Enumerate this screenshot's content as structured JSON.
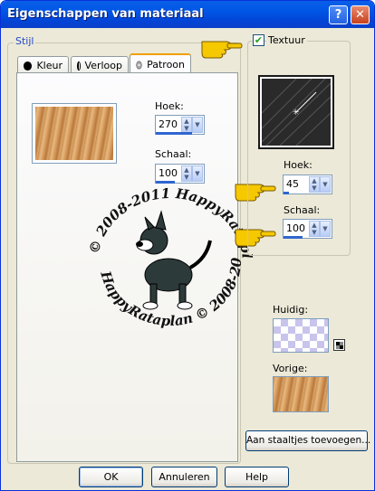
{
  "window": {
    "title": "Eigenschappen van materiaal",
    "help": "?",
    "close": "✕"
  },
  "style_group": {
    "label": "Stijl"
  },
  "tabs": [
    {
      "label": "Kleur",
      "icon": "black-circle-icon"
    },
    {
      "label": "Verloop",
      "icon": "half-circle-icon"
    },
    {
      "label": "Patroon",
      "icon": "pattern-icon"
    }
  ],
  "pattern": {
    "angle_label": "Hoek:",
    "angle_value": "270",
    "angle_fill": 0.75,
    "scale_label": "Schaal:",
    "scale_value": "100",
    "scale_fill": 0.4
  },
  "texture": {
    "checkbox_label": "Textuur",
    "checked": true,
    "angle_label": "Hoek:",
    "angle_value": "45",
    "angle_fill": 0.12,
    "scale_label": "Schaal:",
    "scale_value": "100",
    "scale_fill": 0.4
  },
  "current": {
    "label": "Huidig:"
  },
  "previous": {
    "label": "Vorige:"
  },
  "add_swatch_button": "Aan staaltjes toevoegen...",
  "watermark": {
    "text_top": "© 2008-2011 HappyRataplan",
    "text_bottom": "HappyRataplan © 2008-2011"
  },
  "buttons": {
    "ok": "OK",
    "cancel": "Annuleren",
    "help": "Help"
  },
  "colors": {
    "title_bar": "#0055e5",
    "dialog_bg": "#ece9d8",
    "group_label": "#2149c6",
    "hand_pointer": "#f5c800"
  }
}
